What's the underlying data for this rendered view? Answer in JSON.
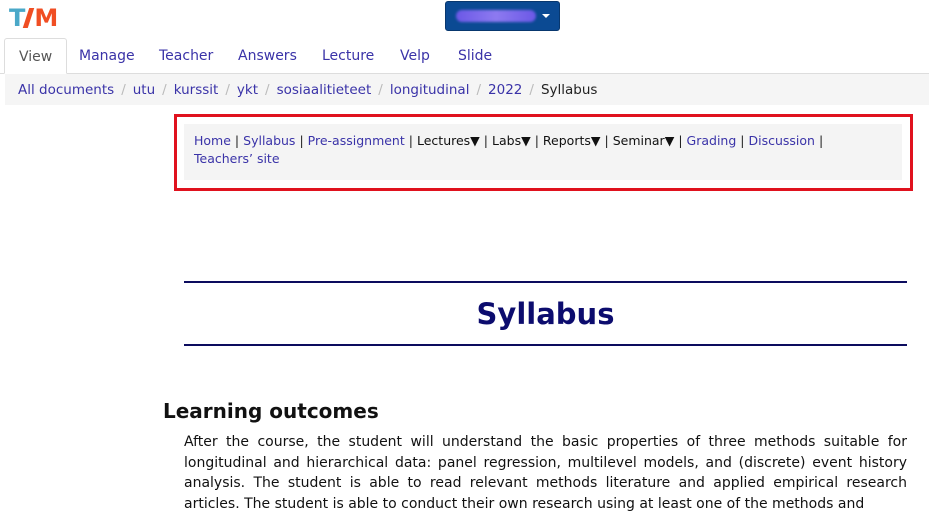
{
  "logo": {
    "text_t": "T",
    "text_m": "M"
  },
  "user_menu": {
    "label": ""
  },
  "tabs": [
    {
      "label": "View",
      "active": true
    },
    {
      "label": "Manage"
    },
    {
      "label": "Teacher"
    },
    {
      "label": "Answers"
    },
    {
      "label": "Lecture"
    },
    {
      "label": "Velp"
    },
    {
      "label": "Slide"
    }
  ],
  "breadcrumb": {
    "items": [
      "All documents",
      "utu",
      "kurssit",
      "ykt",
      "sosiaalitieteet",
      "longitudinal",
      "2022"
    ],
    "current": "Syllabus",
    "separator": "/"
  },
  "course_nav": {
    "items": [
      {
        "label": "Home",
        "type": "link"
      },
      {
        "label": "Syllabus",
        "type": "link"
      },
      {
        "label": "Pre-assignment",
        "type": "link"
      },
      {
        "label": "Lectures▼",
        "type": "dropdown"
      },
      {
        "label": "Labs▼",
        "type": "dropdown"
      },
      {
        "label": "Reports▼",
        "type": "dropdown"
      },
      {
        "label": "Seminar▼",
        "type": "dropdown"
      },
      {
        "label": "Grading",
        "type": "link"
      },
      {
        "label": "Discussion",
        "type": "link"
      },
      {
        "label": "Teachers’ site",
        "type": "link"
      }
    ],
    "separator": "|"
  },
  "page": {
    "title": "Syllabus",
    "section_heading": "Learning outcomes",
    "section_body": "After the course, the student will understand the basic properties of three methods suitable for longitudinal and hierarchical data: panel regression, multilevel models, and (discrete) event history analysis. The student is able to read relevant methods literature and applied empirical research articles. The student is able to conduct their own research using at least one of the methods and"
  },
  "colors": {
    "link": "#3a33a8",
    "title": "#0c0c6e",
    "highlight_border": "#e0121e",
    "user_button": "#0b4a93",
    "logo_t": "#4aa8c8",
    "logo_m": "#f04e23"
  }
}
